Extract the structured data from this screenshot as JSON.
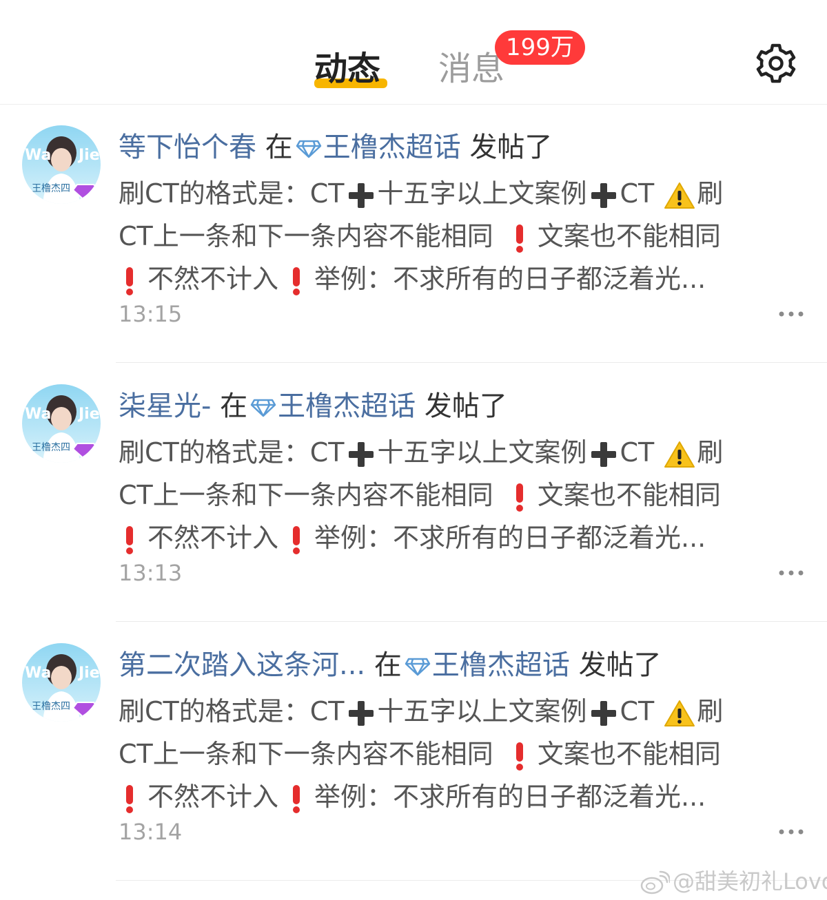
{
  "header": {
    "tabs": [
      {
        "label": "动态",
        "active": true
      },
      {
        "label": "消息",
        "active": false
      }
    ],
    "badge": "199万",
    "settings_icon": "gear-icon",
    "accent_color": "#f7b500",
    "badge_color": "#ff3a3a"
  },
  "feed": {
    "items": [
      {
        "username": "等下怡个春",
        "connector": "在",
        "topic": "王橹杰超话",
        "action": "发帖了",
        "body": {
          "l1a": "刷CT的格式是：CT",
          "l1b": "十五字以上文案例",
          "l1c": "CT ",
          "l1d": "刷",
          "l2a": "CT上一条和下一条内容不能相同 ",
          "l2b": "文案也不能相同",
          "l3a": "不然不计入",
          "l3b": "举例：不求所有的日子都泛着光..."
        },
        "time": "13:15",
        "avatar_text": {
          "line1": "WangJie",
          "line2": "王橹杰四"
        }
      },
      {
        "username": "柒星光-",
        "connector": "在",
        "topic": "王橹杰超话",
        "action": "发帖了",
        "body": {
          "l1a": "刷CT的格式是：CT",
          "l1b": "十五字以上文案例",
          "l1c": "CT ",
          "l1d": "刷",
          "l2a": "CT上一条和下一条内容不能相同 ",
          "l2b": "文案也不能相同",
          "l3a": "不然不计入",
          "l3b": "举例：不求所有的日子都泛着光..."
        },
        "time": "13:13",
        "avatar_text": {
          "line1": "WangJie",
          "line2": "王橹杰四"
        }
      },
      {
        "username": "第二次踏入这条河...",
        "connector": "在",
        "topic": "王橹杰超话",
        "action": "发帖了",
        "body": {
          "l1a": "刷CT的格式是：CT",
          "l1b": "十五字以上文案例",
          "l1c": "CT ",
          "l1d": "刷",
          "l2a": "CT上一条和下一条内容不能相同 ",
          "l2b": "文案也不能相同",
          "l3a": "不然不计入",
          "l3b": "举例：不求所有的日子都泛着光..."
        },
        "time": "13:14",
        "avatar_text": {
          "line1": "WangJie",
          "line2": "王橹杰四"
        }
      }
    ],
    "link_color": "#4a6ea0"
  },
  "watermark": {
    "text": "@甜美初礼Lovo",
    "logo_icon": "weibo-logo-icon"
  }
}
